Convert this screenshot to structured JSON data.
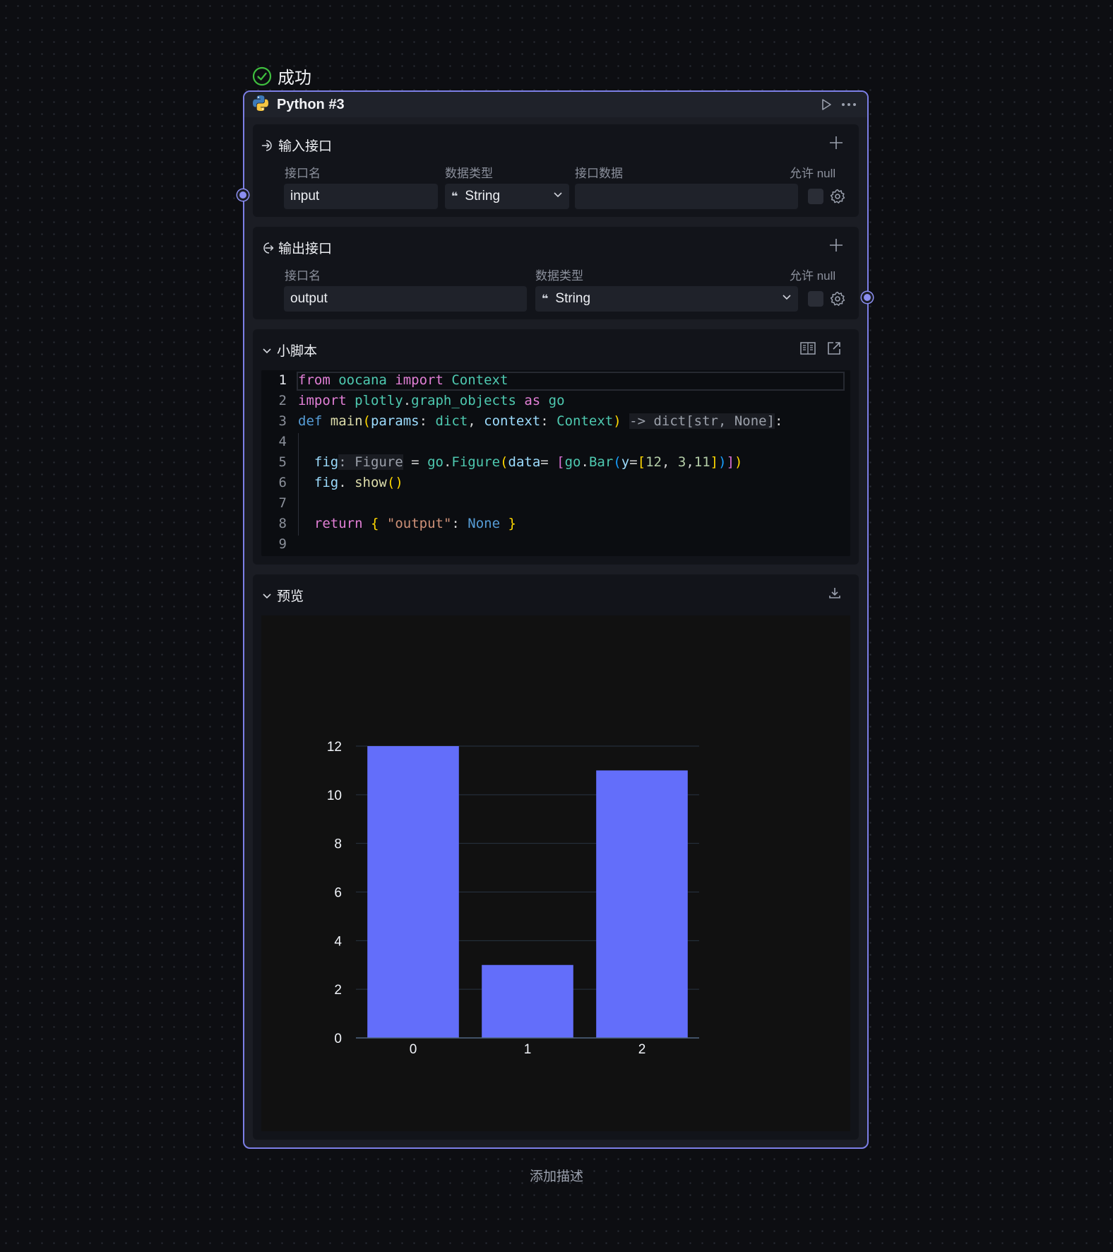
{
  "status": {
    "label": "成功",
    "color": "#3fbf3f"
  },
  "node": {
    "title": "Python #3",
    "icons": {
      "header": "python-icon",
      "run": "play-icon",
      "more": "more-icon"
    },
    "accent": "#7c7fe6"
  },
  "inputs": {
    "title": "输入接口",
    "columns": {
      "name": "接口名",
      "type": "数据类型",
      "data": "接口数据",
      "nullable": "允许 null"
    },
    "rows": [
      {
        "name": "input",
        "type": "String",
        "data": ""
      }
    ]
  },
  "outputs": {
    "title": "输出接口",
    "columns": {
      "name": "接口名",
      "type": "数据类型",
      "nullable": "允许 null"
    },
    "rows": [
      {
        "name": "output",
        "type": "String"
      }
    ]
  },
  "script": {
    "title": "小脚本",
    "line_numbers": [
      "1",
      "2",
      "3",
      "4",
      "5",
      "6",
      "7",
      "8",
      "9"
    ],
    "lines": [
      [
        {
          "t": "from",
          "c": "kw"
        },
        {
          "t": " oocana ",
          "c": "mod"
        },
        {
          "t": "import",
          "c": "kw"
        },
        {
          "t": " Context",
          "c": "cls"
        }
      ],
      [
        {
          "t": "import",
          "c": "kw"
        },
        {
          "t": " plotly",
          "c": "mod"
        },
        {
          "t": ".",
          "c": "op"
        },
        {
          "t": "graph_objects",
          "c": "mod"
        },
        {
          "t": " as",
          "c": "kw"
        },
        {
          "t": " go",
          "c": "mod"
        }
      ],
      [
        {
          "t": "def",
          "c": "const"
        },
        {
          "t": " main",
          "c": "fn"
        },
        {
          "t": "(",
          "c": "br1"
        },
        {
          "t": "params",
          "c": "par"
        },
        {
          "t": ": ",
          "c": "op"
        },
        {
          "t": "dict",
          "c": "cls"
        },
        {
          "t": ", ",
          "c": "op"
        },
        {
          "t": "context",
          "c": "par"
        },
        {
          "t": ": ",
          "c": "op"
        },
        {
          "t": "Context",
          "c": "cls"
        },
        {
          "t": ")",
          "c": "br1"
        },
        {
          "t": " ",
          "c": "op"
        },
        {
          "t": "-> dict[str, None]",
          "c": "hint"
        },
        {
          "t": ":",
          "c": "op"
        }
      ],
      [],
      [
        {
          "t": "  ",
          "c": "op"
        },
        {
          "t": "fig",
          "c": "par"
        },
        {
          "t": ": Figure",
          "c": "hint"
        },
        {
          "t": " = ",
          "c": "op"
        },
        {
          "t": "go",
          "c": "mod"
        },
        {
          "t": ".",
          "c": "op"
        },
        {
          "t": "Figure",
          "c": "cls"
        },
        {
          "t": "(",
          "c": "br1"
        },
        {
          "t": "data",
          "c": "par"
        },
        {
          "t": "= ",
          "c": "op"
        },
        {
          "t": "[",
          "c": "br2"
        },
        {
          "t": "go",
          "c": "mod"
        },
        {
          "t": ".",
          "c": "op"
        },
        {
          "t": "Bar",
          "c": "cls"
        },
        {
          "t": "(",
          "c": "br3"
        },
        {
          "t": "y",
          "c": "par"
        },
        {
          "t": "=",
          "c": "op"
        },
        {
          "t": "[",
          "c": "br1"
        },
        {
          "t": "12",
          "c": "num"
        },
        {
          "t": ", ",
          "c": "op"
        },
        {
          "t": "3",
          "c": "num"
        },
        {
          "t": ",",
          "c": "op"
        },
        {
          "t": "11",
          "c": "num"
        },
        {
          "t": "]",
          "c": "br1"
        },
        {
          "t": ")",
          "c": "br3"
        },
        {
          "t": "]",
          "c": "br2"
        },
        {
          "t": ")",
          "c": "br1"
        }
      ],
      [
        {
          "t": "  ",
          "c": "op"
        },
        {
          "t": "fig",
          "c": "par"
        },
        {
          "t": ". ",
          "c": "op"
        },
        {
          "t": "show",
          "c": "fn"
        },
        {
          "t": "()",
          "c": "br1"
        }
      ],
      [],
      [
        {
          "t": "  ",
          "c": "op"
        },
        {
          "t": "return",
          "c": "kw"
        },
        {
          "t": " ",
          "c": "op"
        },
        {
          "t": "{",
          "c": "br1"
        },
        {
          "t": " ",
          "c": "op"
        },
        {
          "t": "\"output\"",
          "c": "str"
        },
        {
          "t": ": ",
          "c": "op"
        },
        {
          "t": "None",
          "c": "const"
        },
        {
          "t": " ",
          "c": "op"
        },
        {
          "t": "}",
          "c": "br1"
        }
      ],
      []
    ]
  },
  "preview": {
    "title": "预览"
  },
  "chart_data": {
    "type": "bar",
    "categories": [
      "0",
      "1",
      "2"
    ],
    "values": [
      12,
      3,
      11
    ],
    "ylim": [
      0,
      12
    ],
    "yticks": [
      0,
      2,
      4,
      6,
      8,
      10,
      12
    ],
    "grid": true,
    "bar_color": "#636efa",
    "title": "",
    "xlabel": "",
    "ylabel": ""
  },
  "footer": {
    "add_description": "添加描述"
  }
}
